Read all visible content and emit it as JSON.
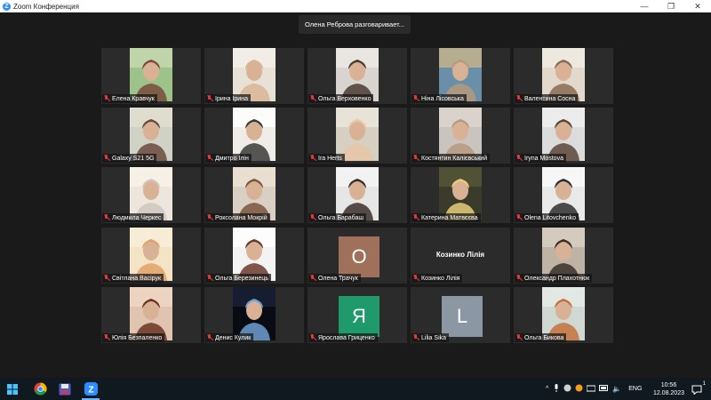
{
  "window": {
    "title": "Zoom Конференция",
    "logo_letter": "Z"
  },
  "speaker_banner": "Олена Реброва разговаривает...",
  "participants": [
    {
      "name": "Елена Кравчук",
      "muted": true,
      "display": "video"
    },
    {
      "name": "Ірина Ірина",
      "muted": true,
      "display": "video"
    },
    {
      "name": "Ольга Верховенко",
      "muted": true,
      "display": "video"
    },
    {
      "name": "Ніна Лісовська",
      "muted": true,
      "display": "video"
    },
    {
      "name": "Валентина Сосна",
      "muted": true,
      "display": "video"
    },
    {
      "name": "Galaxy S21 5G",
      "muted": true,
      "display": "video"
    },
    {
      "name": "Дмитро Ілін",
      "muted": true,
      "display": "video"
    },
    {
      "name": "Ira Herts",
      "muted": true,
      "display": "video"
    },
    {
      "name": "Костянтин Калієвський",
      "muted": true,
      "display": "video"
    },
    {
      "name": "Iryna Mostova",
      "muted": true,
      "display": "video"
    },
    {
      "name": "Людмила Черкес",
      "muted": true,
      "display": "video"
    },
    {
      "name": "Роксолана Мокрій",
      "muted": true,
      "display": "video"
    },
    {
      "name": "Ольга Барабаш",
      "muted": true,
      "display": "video"
    },
    {
      "name": "Катерина Матвєєва",
      "muted": true,
      "display": "video"
    },
    {
      "name": "Olena Litovchenko",
      "muted": true,
      "display": "video"
    },
    {
      "name": "Світлана Васірук",
      "muted": true,
      "display": "video"
    },
    {
      "name": "Ольга Березинець",
      "muted": true,
      "display": "video"
    },
    {
      "name": "Олена Трачук",
      "muted": true,
      "display": "avatar",
      "avatar_letter": "O",
      "avatar_color": "#a0715a"
    },
    {
      "name": "Козинко Лілія",
      "muted": true,
      "display": "name",
      "big_name": "Козинко Лілія"
    },
    {
      "name": "Олександр Плахотнюк",
      "muted": true,
      "display": "video"
    },
    {
      "name": "Юлія Безпаленко",
      "muted": true,
      "display": "video"
    },
    {
      "name": "Денис Кулик",
      "muted": true,
      "display": "video"
    },
    {
      "name": "Ярослава Гриценко",
      "muted": true,
      "display": "avatar",
      "avatar_letter": "Я",
      "avatar_color": "#1f9a6d"
    },
    {
      "name": "Lilia Sika",
      "muted": true,
      "display": "avatar",
      "avatar_letter": "L",
      "avatar_color": "#8b97a3"
    },
    {
      "name": "Ольга Бикова",
      "muted": true,
      "display": "video"
    }
  ],
  "taskbar": {
    "icons": [
      "windows-start-icon",
      "chrome-icon",
      "save-app-icon",
      "zoom-icon"
    ],
    "language": "ENG",
    "time": "10:56",
    "date": "12.08.2023",
    "notification_count": "1"
  }
}
